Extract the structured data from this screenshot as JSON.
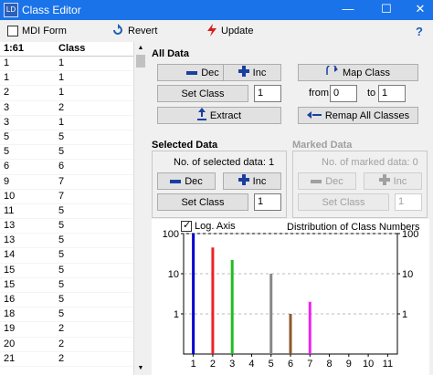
{
  "window": {
    "title": "Class Editor",
    "app_icon_text": "LD"
  },
  "toolbar": {
    "mdi_label": "MDI Form",
    "revert_label": "Revert",
    "update_label": "Update",
    "help_label": "?"
  },
  "table": {
    "header_count": "1:61",
    "header_class": "Class",
    "rows": [
      [
        "1",
        "1"
      ],
      [
        "1",
        "1"
      ],
      [
        "2",
        "1"
      ],
      [
        "3",
        "2"
      ],
      [
        "3",
        "1"
      ],
      [
        "5",
        "5"
      ],
      [
        "5",
        "5"
      ],
      [
        "6",
        "6"
      ],
      [
        "9",
        "7"
      ],
      [
        "10",
        "7"
      ],
      [
        "11",
        "5"
      ],
      [
        "13",
        "5"
      ],
      [
        "13",
        "5"
      ],
      [
        "14",
        "5"
      ],
      [
        "15",
        "5"
      ],
      [
        "15",
        "5"
      ],
      [
        "16",
        "5"
      ],
      [
        "18",
        "5"
      ],
      [
        "19",
        "2"
      ],
      [
        "20",
        "2"
      ],
      [
        "21",
        "2"
      ]
    ]
  },
  "all_data": {
    "title": "All Data",
    "dec_label": "Dec",
    "inc_label": "Inc",
    "map_class_label": "Map Class",
    "set_class_label": "Set Class",
    "set_class_value": "1",
    "from_label": "from",
    "from_value": "0",
    "to_label": "to",
    "to_value": "1",
    "extract_label": "Extract",
    "remap_label": "Remap All Classes"
  },
  "selected_data": {
    "title": "Selected Data",
    "count_text": "No. of selected data:  1",
    "dec_label": "Dec",
    "inc_label": "Inc",
    "set_class_label": "Set Class",
    "set_class_value": "1"
  },
  "marked_data": {
    "title": "Marked Data",
    "count_text": "No. of marked data:  0",
    "dec_label": "Dec",
    "inc_label": "Inc",
    "set_class_label": "Set Class",
    "set_class_value": "1"
  },
  "chart_panel": {
    "log_axis_label": "Log. Axis",
    "log_axis_checked": true
  },
  "chart_data": {
    "type": "bar",
    "title": "Distribution of Class Numbers",
    "x": [
      1,
      2,
      3,
      4,
      5,
      6,
      7,
      8,
      9,
      10,
      11
    ],
    "x_ticks": [
      "1",
      "2",
      "3",
      "4",
      "5",
      "6",
      "7",
      "8",
      "9",
      "10",
      "11"
    ],
    "values": [
      100,
      45,
      22,
      0,
      10,
      1,
      2,
      0,
      0,
      0,
      0
    ],
    "colors": [
      "#0000cc",
      "#ee2222",
      "#22bb22",
      "#000000",
      "#888888",
      "#8b5a2b",
      "#ee22ee",
      "#000000",
      "#000000",
      "#000000",
      "#000000"
    ],
    "y_scale": "log",
    "ylim": [
      0.1,
      100
    ],
    "y_ticks": [
      "1",
      "10",
      "100"
    ],
    "grid": true,
    "xlabel": "",
    "ylabel": ""
  }
}
